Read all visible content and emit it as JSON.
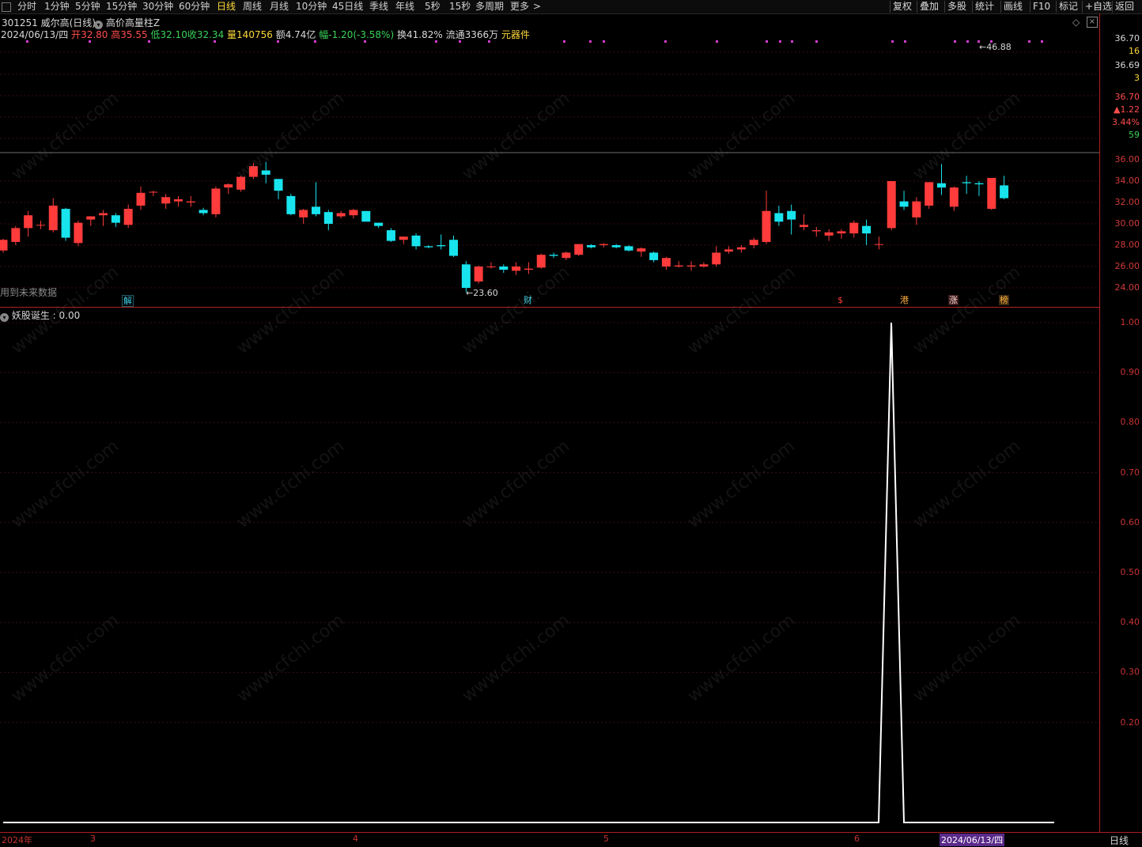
{
  "toolbar": {
    "tabs": [
      "分时",
      "1分钟",
      "5分钟",
      "15分钟",
      "30分钟",
      "60分钟",
      "日线",
      "周线",
      "月线",
      "10分钟",
      "45日线",
      "季线",
      "年线",
      "5秒",
      "15秒",
      "多周期",
      "更多"
    ],
    "active": "日线",
    "right": [
      "复权",
      "叠加",
      "多股",
      "统计",
      "画线",
      "F10",
      "标记",
      "+自选",
      "返回"
    ]
  },
  "stock": {
    "code_name": "301251 威尔高(日线)",
    "indicator": "高价高量柱Z",
    "date": "2024/06/13/四",
    "open_label": "开",
    "open": "32.80",
    "high_label": "高",
    "high": "35.55",
    "low_label": "低",
    "low": "32.10",
    "close_label": "收",
    "close": "32.34",
    "vol_label": "量",
    "vol": "140756",
    "amt_label": "额",
    "amt": "4.74亿",
    "chg_label": "幅",
    "chg": "-1.20(-3.58%)",
    "turn_label": "换",
    "turn": "41.82%",
    "float_label": "流通",
    "float": "3366万",
    "sector": "元器件"
  },
  "future_data_note": "用到未来数据",
  "price_axis": {
    "top_price": "36.70",
    "top_count": "16",
    "mid_price": "36.69",
    "mid_count": "3",
    "info_price": "36.70",
    "info_delta": "▲1.22",
    "info_pct": "3.44%",
    "info_num": "59",
    "ticks": [
      "36.00",
      "34.00",
      "32.00",
      "30.00",
      "28.00",
      "26.00",
      "24.00"
    ]
  },
  "annotations": {
    "high_marker": "46.88",
    "low_marker": "23.60"
  },
  "events": [
    "解",
    "财",
    "$",
    "港",
    "涨",
    "榜"
  ],
  "indicator_panel": {
    "title": "妖股诞生",
    "value_text": ": 0.00",
    "ticks": [
      "1.00",
      "0.90",
      "0.80",
      "0.70",
      "0.60",
      "0.50",
      "0.40",
      "0.30",
      "0.20"
    ]
  },
  "x_axis": {
    "labels": [
      "2024年",
      "3",
      "4",
      "5",
      "6"
    ],
    "cursor_date": "2024/06/13/四",
    "period": "日线"
  },
  "watermark": "www.cfchi.com",
  "candles": [
    [
      27.5,
      28.6,
      27.3,
      28.5
    ],
    [
      28.3,
      29.8,
      28.0,
      29.6
    ],
    [
      29.6,
      31.2,
      28.8,
      30.8
    ],
    [
      29.9,
      30.3,
      29.5,
      29.9
    ],
    [
      29.4,
      32.4,
      29.2,
      31.7
    ],
    [
      31.4,
      31.5,
      28.4,
      28.7
    ],
    [
      28.2,
      30.3,
      27.9,
      30.1
    ],
    [
      30.4,
      30.7,
      29.8,
      30.7
    ],
    [
      30.8,
      31.3,
      29.8,
      31.0
    ],
    [
      30.8,
      31.0,
      29.7,
      30.1
    ],
    [
      29.9,
      31.8,
      29.6,
      31.4
    ],
    [
      31.7,
      33.5,
      31.3,
      32.9
    ],
    [
      33.0,
      33.1,
      32.6,
      33.0
    ],
    [
      31.9,
      32.8,
      31.4,
      32.5
    ],
    [
      32.1,
      32.6,
      31.6,
      32.3
    ],
    [
      32.0,
      32.6,
      31.6,
      32.1
    ],
    [
      31.3,
      31.5,
      30.8,
      31.0
    ],
    [
      30.9,
      33.5,
      30.6,
      33.3
    ],
    [
      33.4,
      33.8,
      32.8,
      33.7
    ],
    [
      33.2,
      34.5,
      33.0,
      34.4
    ],
    [
      34.4,
      35.7,
      34.2,
      35.4
    ],
    [
      35.0,
      35.8,
      33.8,
      34.6
    ],
    [
      34.2,
      34.2,
      32.3,
      33.1
    ],
    [
      32.6,
      32.8,
      30.8,
      30.9
    ],
    [
      30.6,
      31.4,
      30.0,
      31.3
    ],
    [
      31.6,
      33.9,
      30.7,
      30.9
    ],
    [
      31.1,
      31.3,
      29.4,
      30.0
    ],
    [
      30.7,
      31.2,
      30.5,
      31.0
    ],
    [
      30.8,
      31.4,
      30.5,
      31.3
    ],
    [
      31.2,
      31.2,
      30.2,
      30.2
    ],
    [
      30.1,
      30.1,
      29.6,
      29.8
    ],
    [
      29.4,
      29.6,
      28.3,
      28.4
    ],
    [
      28.5,
      28.8,
      28.1,
      28.8
    ],
    [
      28.9,
      29.1,
      27.6,
      27.9
    ],
    [
      27.9,
      28.0,
      27.7,
      27.8
    ],
    [
      28.0,
      29.0,
      27.6,
      27.9
    ],
    [
      28.5,
      28.9,
      26.9,
      27.0
    ],
    [
      26.2,
      26.5,
      23.6,
      24.0
    ],
    [
      24.6,
      26.1,
      24.4,
      26.0
    ],
    [
      26.0,
      26.4,
      25.8,
      26.0
    ],
    [
      26.0,
      26.2,
      25.4,
      25.7
    ],
    [
      25.6,
      26.4,
      25.2,
      26.0
    ],
    [
      25.7,
      26.4,
      25.3,
      25.8
    ],
    [
      25.9,
      27.2,
      25.8,
      27.1
    ],
    [
      27.1,
      27.3,
      26.8,
      27.0
    ],
    [
      26.8,
      27.4,
      26.6,
      27.3
    ],
    [
      27.1,
      28.1,
      27.0,
      28.1
    ],
    [
      28.0,
      28.1,
      27.7,
      27.8
    ],
    [
      28.0,
      28.2,
      27.8,
      28.1
    ],
    [
      28.0,
      28.1,
      27.7,
      27.8
    ],
    [
      27.9,
      28.0,
      27.4,
      27.5
    ],
    [
      27.4,
      27.8,
      26.9,
      27.7
    ],
    [
      27.3,
      27.4,
      26.4,
      26.6
    ],
    [
      26.0,
      26.9,
      25.7,
      26.8
    ],
    [
      26.0,
      26.5,
      25.9,
      26.1
    ],
    [
      26.0,
      26.5,
      25.6,
      26.1
    ],
    [
      26.0,
      26.4,
      25.9,
      26.2
    ],
    [
      26.2,
      27.9,
      26.0,
      27.3
    ],
    [
      27.4,
      27.9,
      27.2,
      27.6
    ],
    [
      27.6,
      28.0,
      27.3,
      27.8
    ],
    [
      28.0,
      28.7,
      27.7,
      28.5
    ],
    [
      28.3,
      33.1,
      28.1,
      31.2
    ],
    [
      31.0,
      31.7,
      29.8,
      30.2
    ],
    [
      31.2,
      31.8,
      29.0,
      30.4
    ],
    [
      29.7,
      30.9,
      29.4,
      29.9
    ],
    [
      29.3,
      29.7,
      28.8,
      29.4
    ],
    [
      28.9,
      29.5,
      28.4,
      29.2
    ],
    [
      29.1,
      29.5,
      28.6,
      29.3
    ],
    [
      29.1,
      30.3,
      28.7,
      30.1
    ],
    [
      29.8,
      30.4,
      28.0,
      29.1
    ],
    [
      28.1,
      28.8,
      27.6,
      28.1
    ],
    [
      29.6,
      34.0,
      29.4,
      34.0
    ],
    [
      32.1,
      33.1,
      31.3,
      31.6
    ],
    [
      30.6,
      32.5,
      29.9,
      32.1
    ],
    [
      31.7,
      33.9,
      31.4,
      33.9
    ],
    [
      33.8,
      35.6,
      32.7,
      33.4
    ],
    [
      31.6,
      33.5,
      31.2,
      33.4
    ],
    [
      33.9,
      34.5,
      32.8,
      33.8
    ],
    [
      33.8,
      34.0,
      32.6,
      33.7
    ],
    [
      31.4,
      34.2,
      31.3,
      34.3
    ],
    [
      33.6,
      34.5,
      32.3,
      32.4
    ]
  ]
}
